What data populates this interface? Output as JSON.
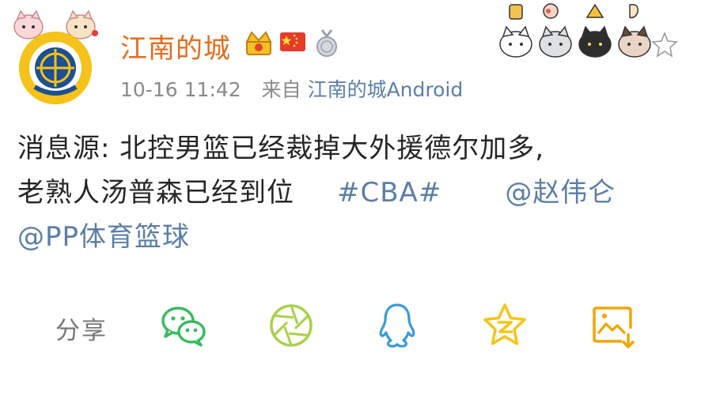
{
  "post": {
    "username": "江南的城",
    "timestamp": "10-16 11:42",
    "source_prefix": "来自",
    "source_app": "江南的城Android",
    "text_line1": "消息源: 北控男篮已经裁掉大外援德尔加多,",
    "text_line2": "老熟人汤普森已经到位",
    "hashtag": "#CBA#",
    "mention1": "@赵伟仑",
    "mention2": "@PP体育篮球"
  },
  "share": {
    "label": "分享",
    "targets": [
      "wechat",
      "moments",
      "qq",
      "qzone",
      "save-image"
    ]
  },
  "colors": {
    "username": "#e46b1e",
    "link": "#5b7ea6",
    "wechat": "#3cba5f",
    "moments": "#a9d14a",
    "qq": "#3b9ad9",
    "qzone": "#f5c518",
    "save": "#f0a500"
  }
}
